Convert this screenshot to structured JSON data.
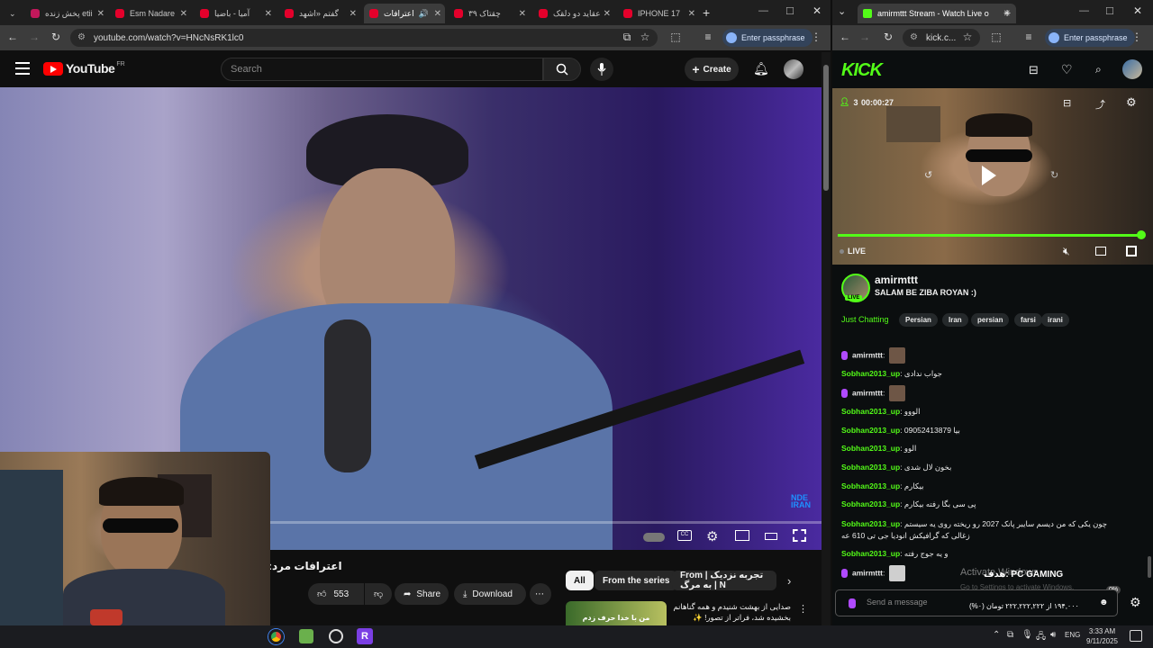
{
  "left_browser": {
    "tabs": [
      {
        "label": "پخش زنده etii",
        "active": false
      },
      {
        "label": "Esm Nadare",
        "active": false
      },
      {
        "label": "آمیا - باضیا",
        "active": false
      },
      {
        "label": "گفتم «اشهد",
        "active": false
      },
      {
        "label": "اعترافات",
        "active": true
      },
      {
        "label": "چقتاک ۳۹",
        "active": false
      },
      {
        "label": "عقاید دو دلقک",
        "active": false
      },
      {
        "label": "IPHONE 17",
        "active": false
      }
    ],
    "url": "youtube.com/watch?v=HNcNsRK1lc0",
    "passphrase_label": "Enter passphrase"
  },
  "youtube": {
    "logo_text": "YouTube",
    "region": "FR",
    "search_placeholder": "Search",
    "create_label": "Create",
    "video_title": "اعترافات مرد:",
    "like_count": "553",
    "share_label": "Share",
    "download_label": "Download",
    "chips": [
      "All",
      "From the series",
      "From | تجربه نزدیک به مرگ | N"
    ],
    "rec_title": "صدایی از بهشت شنیدم و همه گناهانم بخشیده شد، فراتر از تصور! ✨",
    "rec_thumb_text": "من با خدا حرف زدم"
  },
  "right_browser": {
    "tab_label": "amirmttt Stream - Watch Live o",
    "url": "kick.c...",
    "passphrase_label": "Enter passphrase"
  },
  "kick": {
    "logo_text": "KICK",
    "viewers": "3",
    "uptime": "00:00:27",
    "live_label": "LIVE",
    "streamer": "amirmttt",
    "stream_title": "SALAM BE ZIBA ROYAN :)",
    "category": "Just Chatting",
    "tags": [
      "Persian",
      "Iran",
      "persian",
      "farsi",
      "irani"
    ],
    "chat": [
      {
        "user": "amirmttt",
        "text": "",
        "mod": true,
        "avatar": true
      },
      {
        "user": "Sobhan2013_up",
        "text": "جواب ندادی"
      },
      {
        "user": "amirmttt",
        "text": "",
        "mod": true,
        "avatar": true
      },
      {
        "user": "Sobhan2013_up",
        "text": "الووو"
      },
      {
        "user": "Sobhan2013_up",
        "text": "09052413879 بیا"
      },
      {
        "user": "Sobhan2013_up",
        "text": "الوو"
      },
      {
        "user": "Sobhan2013_up",
        "text": "بخون لال شدی"
      },
      {
        "user": "Sobhan2013_up",
        "text": "بیکارم"
      },
      {
        "user": "Sobhan2013_up",
        "text": "پی سی بگا رفته بیکارم"
      },
      {
        "user": "Sobhan2013_up",
        "text": "چون یکی که من دیسم سایبر پانک 2027 رو ریخته روی یه سیستم زغالی که گرافیکش انودیا جی تی 610 عه"
      },
      {
        "user": "Sobhan2013_up",
        "text": "و یه جوج رفته"
      },
      {
        "user": "amirmttt",
        "text": "",
        "mod": true,
        "avatar": true
      }
    ],
    "goal_label": "هدف: PC GAMING",
    "goal_progress": "۱۹۴,۰۰۰ از ۲۲۲,۲۲۲,۲۲۲ تومان (۰%)",
    "goal_percent": "0%",
    "watermark_line1": "Activate Windows",
    "watermark_line2": "Go to Settings to activate Windows.",
    "send_placeholder": "Send a message"
  },
  "taskbar": {
    "time": "3:33 AM",
    "date": "9/11/2025",
    "lang": "ENG"
  },
  "colors": {
    "kick_green": "#53fc18",
    "yt_red": "#ff0000"
  }
}
